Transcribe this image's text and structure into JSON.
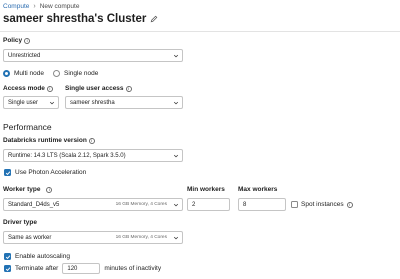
{
  "breadcrumb": {
    "root": "Compute",
    "current": "New compute"
  },
  "title": "sameer shrestha's Cluster",
  "policy": {
    "label": "Policy",
    "value": "Unrestricted"
  },
  "node_mode": {
    "multi": "Multi node",
    "single": "Single node",
    "selected": "multi"
  },
  "access_mode": {
    "label": "Access mode",
    "value": "Single user"
  },
  "single_user_access": {
    "label": "Single user access",
    "value": "sameer shrestha"
  },
  "performance": {
    "heading": "Performance",
    "runtime_label": "Databricks runtime version",
    "runtime_value": "Runtime: 14.3 LTS (Scala 2.12, Spark 3.5.0)",
    "photon_label": "Use Photon Acceleration",
    "photon_checked": true
  },
  "worker": {
    "type_label": "Worker type",
    "type_value": "Standard_D4ds_v5",
    "type_note": "16 GB Memory, 4 Cores",
    "min_label": "Min workers",
    "min_value": "2",
    "max_label": "Max workers",
    "max_value": "8",
    "spot_label": "Spot instances",
    "spot_checked": false
  },
  "driver": {
    "type_label": "Driver type",
    "type_value": "Same as worker",
    "type_note": "16 GB Memory, 4 Cores"
  },
  "autoscaling": {
    "label": "Enable autoscaling",
    "checked": true
  },
  "terminate": {
    "prefix": "Terminate after",
    "value": "120",
    "suffix": "minutes of inactivity",
    "checked": true
  }
}
